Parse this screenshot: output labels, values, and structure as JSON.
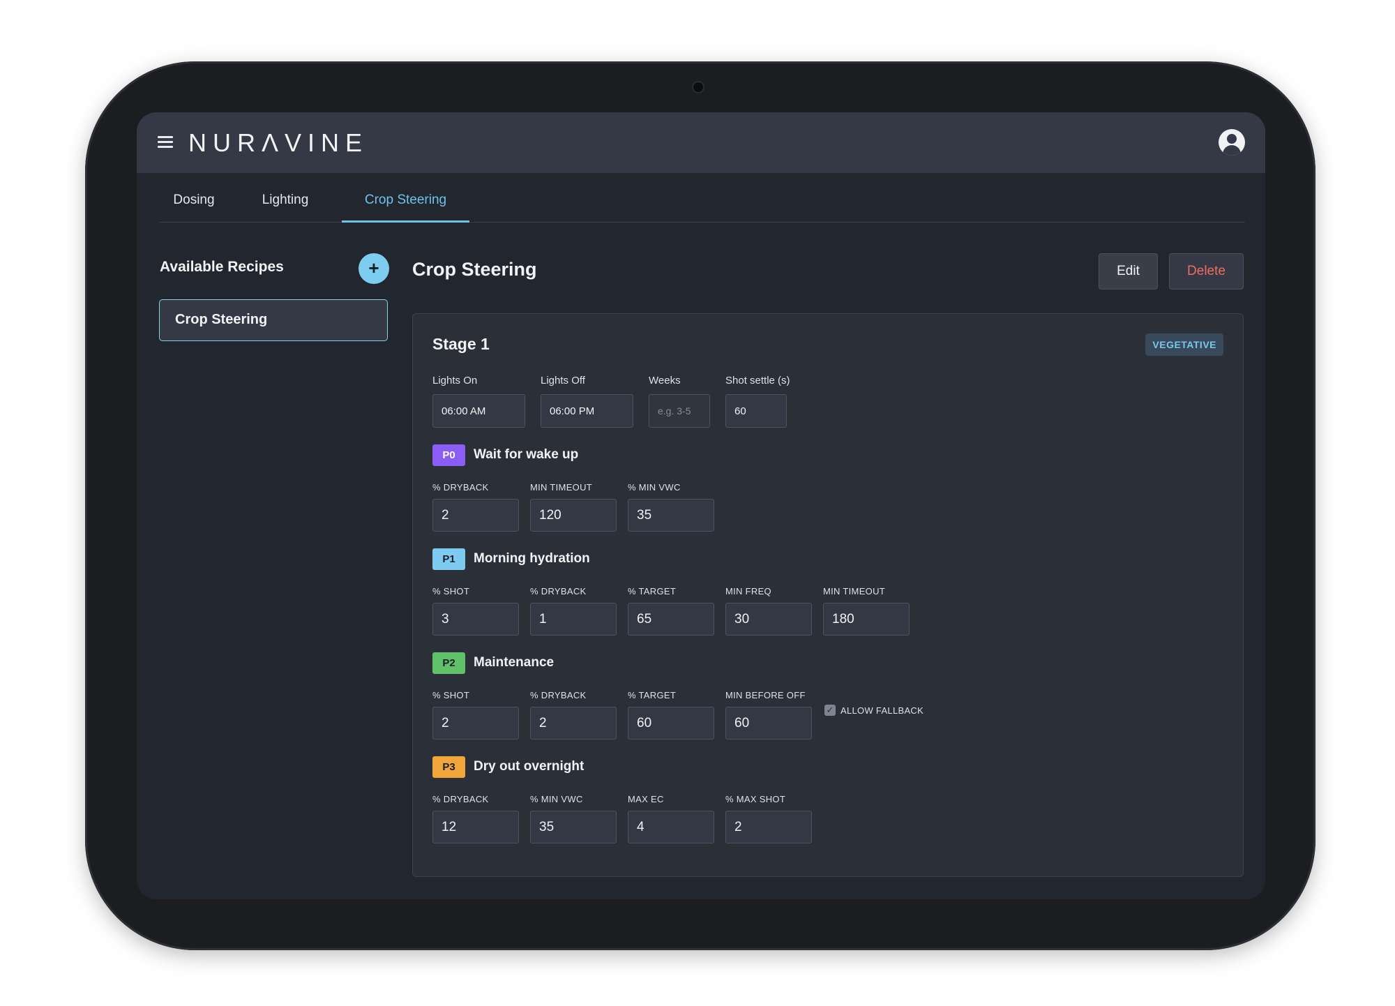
{
  "app": {
    "brand": "NURΛVINE"
  },
  "tabs": [
    {
      "label": "Dosing",
      "active": false
    },
    {
      "label": "Lighting",
      "active": false
    },
    {
      "label": "Crop Steering",
      "active": true
    }
  ],
  "sidebar": {
    "title": "Available Recipes",
    "add_label": "+",
    "recipes": [
      "Crop Steering"
    ]
  },
  "main": {
    "title": "Crop Steering",
    "edit_label": "Edit",
    "delete_label": "Delete",
    "stage": {
      "title": "Stage 1",
      "badge": "VEGETATIVE",
      "lights_on_label": "Lights On",
      "lights_on_value": "06:00 AM",
      "lights_off_label": "Lights Off",
      "lights_off_value": "06:00 PM",
      "weeks_label": "Weeks",
      "weeks_placeholder": "e.g. 3-5",
      "shot_settle_label": "Shot settle (s)",
      "shot_settle_value": "60"
    },
    "phases": [
      {
        "code": "P0",
        "name": "Wait for wake up",
        "color": "#8b5cf6",
        "fields": [
          {
            "label": "% DRYBACK",
            "value": "2"
          },
          {
            "label": "MIN TIMEOUT",
            "value": "120"
          },
          {
            "label": "% MIN VWC",
            "value": "35"
          }
        ]
      },
      {
        "code": "P1",
        "name": "Morning hydration",
        "color": "#7dcbf0",
        "fields": [
          {
            "label": "% SHOT",
            "value": "3"
          },
          {
            "label": "% DRYBACK",
            "value": "1"
          },
          {
            "label": "% TARGET",
            "value": "65"
          },
          {
            "label": "MIN FREQ",
            "value": "30"
          },
          {
            "label": "MIN TIMEOUT",
            "value": "180"
          }
        ]
      },
      {
        "code": "P2",
        "name": "Maintenance",
        "color": "#5fc16a",
        "fields": [
          {
            "label": "% SHOT",
            "value": "2"
          },
          {
            "label": "% DRYBACK",
            "value": "2"
          },
          {
            "label": "% TARGET",
            "value": "60"
          },
          {
            "label": "MIN BEFORE OFF",
            "value": "60"
          }
        ],
        "checkbox": {
          "label": "ALLOW FALLBACK",
          "checked": true
        }
      },
      {
        "code": "P3",
        "name": "Dry out overnight",
        "color": "#f0a63a",
        "fields": [
          {
            "label": "% DRYBACK",
            "value": "12"
          },
          {
            "label": "% MIN VWC",
            "value": "35"
          },
          {
            "label": "MAX EC",
            "value": "4"
          },
          {
            "label": "% MAX SHOT",
            "value": "2"
          }
        ]
      }
    ]
  },
  "colors": {
    "accent": "#6fc3ea",
    "danger": "#ee6e64",
    "appbar": "#343945",
    "background": "#22262e"
  }
}
